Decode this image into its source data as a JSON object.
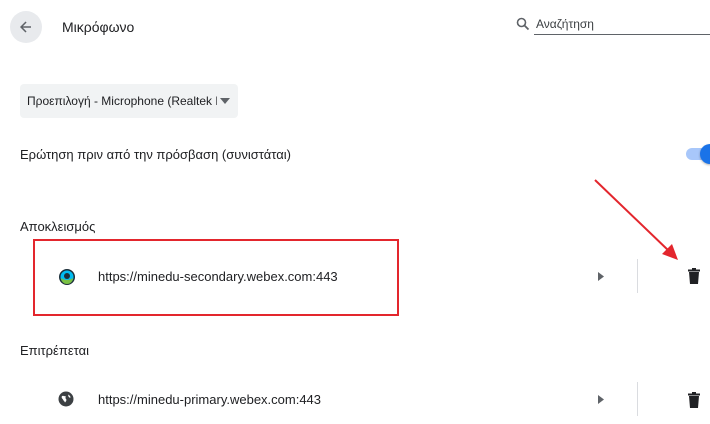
{
  "header": {
    "back_icon": "arrow-left-icon",
    "title": "Μικρόφωνο",
    "search": {
      "icon": "search-icon",
      "placeholder": "Αναζήτηση",
      "value": ""
    }
  },
  "device_select": {
    "selected": "Προεπιλογή - Microphone (Realtek High Definition Audio)",
    "icon": "caret-down-icon"
  },
  "ask_before_access": {
    "label": "Ερώτηση πριν από την πρόσβαση (συνιστάται)",
    "enabled": true
  },
  "sections": {
    "blocked": {
      "heading": "Αποκλεισμός",
      "sites": [
        {
          "url": "https://minedu-secondary.webex.com:443",
          "favicon": "webex-icon"
        }
      ]
    },
    "allowed": {
      "heading": "Επιτρέπεται",
      "sites": [
        {
          "url": "https://minedu-primary.webex.com:443",
          "favicon": "globe-icon"
        }
      ]
    }
  },
  "row_icons": {
    "expand": "triangle-right-icon",
    "delete": "trash-icon"
  },
  "colors": {
    "toggle_on": "#1a73e8",
    "toggle_track": "#a8c7fa",
    "annotation_red": "#e3262d",
    "select_bg": "#f1f3f4"
  }
}
